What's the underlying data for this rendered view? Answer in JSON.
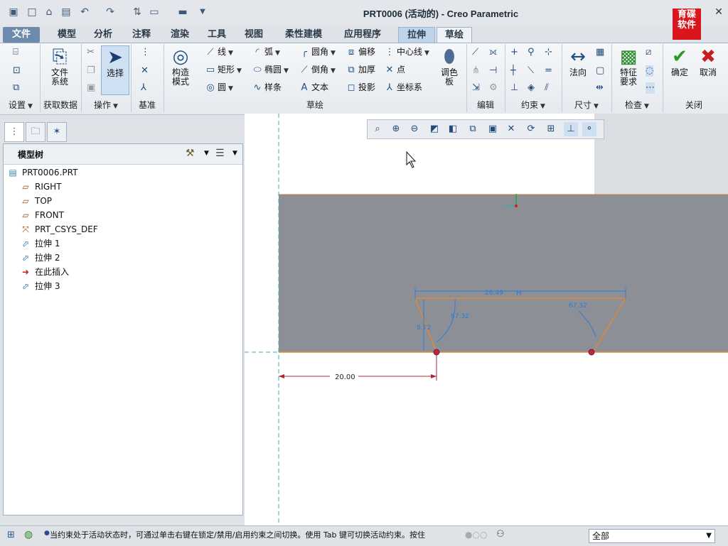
{
  "window": {
    "title": "PRT0006 (活动的) - Creo Parametric",
    "logo_text": "育碟\n软件"
  },
  "quick_access": [
    "app-icon",
    "new-icon",
    "open-icon",
    "save-icon",
    "undo-icon",
    "redo-icon",
    "regenerate-icon",
    "window-icon",
    "close-window-icon",
    "customize-icon"
  ],
  "tabs": {
    "file": "文件",
    "items": [
      "模型",
      "分析",
      "注释",
      "渲染",
      "工具",
      "视图",
      "柔性建模",
      "应用程序"
    ],
    "extrude": "拉伸",
    "sketch": "草绘"
  },
  "ribbon": {
    "groups": [
      "设置",
      "获取数据",
      "操作",
      "基准",
      "草绘",
      "编辑",
      "约束",
      "尺寸",
      "检查",
      "关闭"
    ],
    "file_system": "文件\n系统",
    "select": "选择",
    "construction_mode": "构造\n模式",
    "sketch_tools": {
      "line": "线",
      "arc": "弧",
      "fillet": "圆角",
      "offset": "偏移",
      "centerline": "中心线",
      "rectangle": "矩形",
      "ellipse": "椭圆",
      "chamfer": "倒角",
      "thicken": "加厚",
      "point": "点",
      "circle": "圆",
      "spline": "样条",
      "text": "文本",
      "project": "投影",
      "coord_sys": "坐标系"
    },
    "palette": "调色\n板",
    "normal": "法向",
    "feature_req": "特征\n要求",
    "ok": "确定",
    "cancel": "取消"
  },
  "model_tree": {
    "title": "模型树",
    "items": [
      {
        "label": "PRT0006.PRT",
        "icon": "part-icon"
      },
      {
        "label": "RIGHT",
        "icon": "datum-plane-icon"
      },
      {
        "label": "TOP",
        "icon": "datum-plane-icon"
      },
      {
        "label": "FRONT",
        "icon": "datum-plane-icon"
      },
      {
        "label": "PRT_CSYS_DEF",
        "icon": "csys-icon"
      },
      {
        "label": "拉伸 1",
        "icon": "extrude-icon"
      },
      {
        "label": "拉伸 2",
        "icon": "extrude-icon"
      },
      {
        "label": "在此插入",
        "icon": "insert-arrow-icon"
      },
      {
        "label": "拉伸 3",
        "icon": "extrude-new-icon"
      }
    ]
  },
  "sketch": {
    "dim_horizontal": "20.00",
    "dim_top": "26.49",
    "constraint_h": "H",
    "dim_left_height": "8.72",
    "dim_left_angle": "67.32",
    "dim_right_angle": "67.32"
  },
  "status": {
    "message": "当约束处于活动状态时，可通过单击右键在锁定/禁用/启用约束之间切换。使用 Tab 键可切换活动约束。按住",
    "filter_value": "全部"
  },
  "colors": {
    "accent": "#6c8aab",
    "model_gray": "#8c8f96",
    "sketch_orange": "#e0883a",
    "dimension_blue": "#2e7dd6",
    "ok_green": "#2a9a2a",
    "cancel_red": "#c81e1e"
  }
}
